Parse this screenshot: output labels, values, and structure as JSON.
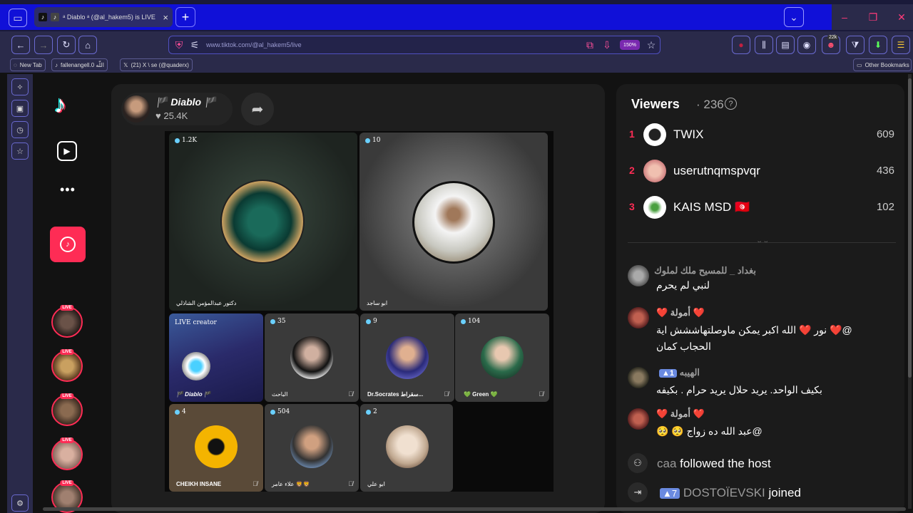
{
  "browser": {
    "tab": {
      "title": "ᵃ Diablo ᵃ (@al_hakem5) is LIVE",
      "close": "×"
    },
    "new_tab": "+",
    "url": "www.tiktok.com/@al_hakem5/live",
    "zoom": "150%",
    "extension_badge": "22k",
    "bookmarks": [
      {
        "label": "New Tab"
      },
      {
        "label": "fallenangell.0 اللّه"
      },
      {
        "label": "(21) X \\ se (@quaderx)"
      }
    ],
    "other_bookmarks": "Other Bookmarks"
  },
  "live": {
    "host_name": "🏴 Diablo 🏴",
    "host_likes": "25.4K",
    "grid": [
      {
        "count": "1.2K",
        "name": "دكتور عبدالمؤمن الشاذلي"
      },
      {
        "count": "10",
        "name": "ابو ساجد"
      },
      {
        "count": "",
        "name": "🏴 Diablo 🏴",
        "label": "LIVE creator"
      },
      {
        "count": "35",
        "name": "الباحث"
      },
      {
        "count": "9",
        "name": "Dr.Socrates سقراط..."
      },
      {
        "count": "104",
        "name": "💚 Green 💚"
      },
      {
        "count": "4",
        "name": "CHEIKH INSANE"
      },
      {
        "count": "504",
        "name": "علاء عامر 🦁🦁"
      },
      {
        "count": "2",
        "name": "ابو علي"
      }
    ]
  },
  "viewers": {
    "title": "Viewers",
    "count": "· 236",
    "help": "?",
    "ranking": [
      {
        "rank": "1",
        "name": "TWIX",
        "score": "609"
      },
      {
        "rank": "2",
        "name": "userutnqmspvqr",
        "score": "436"
      },
      {
        "rank": "3",
        "name": "KAIS MSD 🇹🇳",
        "score": "102"
      }
    ],
    "comments": [
      {
        "name": "بغداد _ للمسيح ملك لملوك",
        "badge": "",
        "text": "لنبي لم يحرم"
      },
      {
        "name": "❤️ أمولة ❤️",
        "badge": "",
        "text": "@❤️ نور ❤️ الله اكبر يمكن ماوصلتهاششش اية",
        "text2": "الحجاب كمان"
      },
      {
        "name": "الهيبه",
        "badge": "1",
        "text": "بكيف الواحد. يريد حلال يريد حرام . بكيفه"
      },
      {
        "name": "❤️ أمولة ❤️",
        "badge": "",
        "text": "@عبد الله ده زواج 🥺 🥺"
      }
    ],
    "events": [
      {
        "user": "caa",
        "action": "followed the host"
      },
      {
        "badge": "7",
        "user": "DOSTOÏEVSKI",
        "action": "joined"
      }
    ]
  },
  "colors": {
    "accent": "#fe2c55",
    "tabstrip": "#1010d8"
  }
}
